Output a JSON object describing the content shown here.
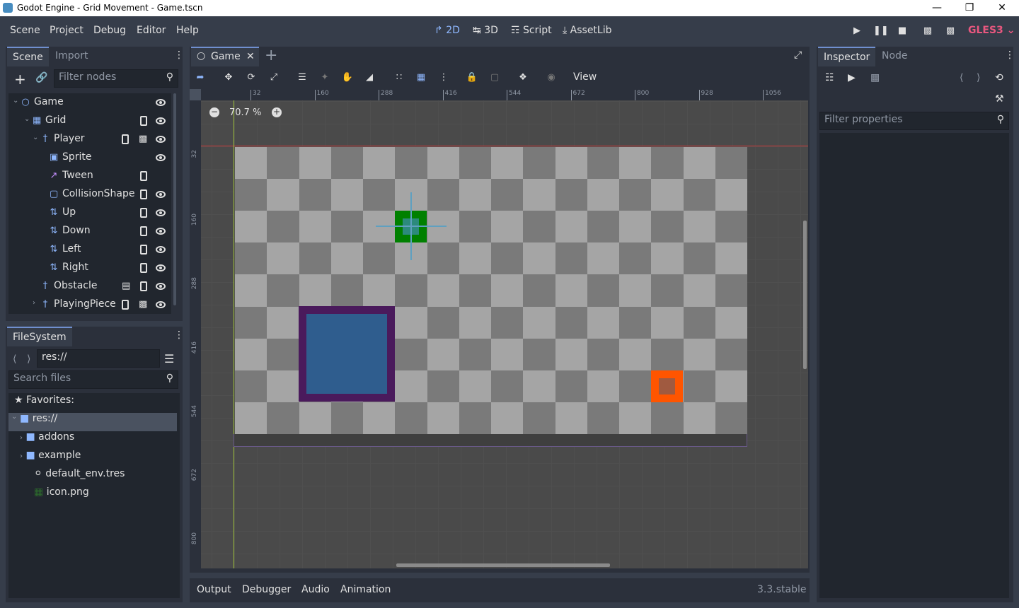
{
  "window": {
    "title": "Godot Engine - Grid Movement - Game.tscn"
  },
  "menu": {
    "scene": "Scene",
    "project": "Project",
    "debug": "Debug",
    "editor": "Editor",
    "help": "Help"
  },
  "workspaces": {
    "w2d": "2D",
    "w3d": "3D",
    "script": "Script",
    "assetlib": "AssetLib"
  },
  "renderer": "GLES3",
  "scene_dock": {
    "tab_scene": "Scene",
    "tab_import": "Import",
    "filter_placeholder": "Filter nodes",
    "nodes": [
      {
        "label": "Game",
        "icon": "node2d-icon"
      },
      {
        "label": "Grid",
        "icon": "tilemap-icon"
      },
      {
        "label": "Player",
        "icon": "pawn-icon"
      },
      {
        "label": "Sprite",
        "icon": "sprite-icon"
      },
      {
        "label": "Tween",
        "icon": "tween-icon"
      },
      {
        "label": "CollisionShape",
        "icon": "collision-icon"
      },
      {
        "label": "Up",
        "icon": "raycast-icon"
      },
      {
        "label": "Down",
        "icon": "raycast-icon"
      },
      {
        "label": "Left",
        "icon": "raycast-icon"
      },
      {
        "label": "Right",
        "icon": "raycast-icon"
      },
      {
        "label": "Obstacle",
        "icon": "pawn-icon"
      },
      {
        "label": "PlayingPiece",
        "icon": "pawn-icon"
      }
    ]
  },
  "filesystem": {
    "tab": "FileSystem",
    "path": "res://",
    "search_placeholder": "Search files",
    "favorites": "Favorites:",
    "items": [
      {
        "label": "res://"
      },
      {
        "label": "addons"
      },
      {
        "label": "example"
      },
      {
        "label": "default_env.tres"
      },
      {
        "label": "icon.png"
      }
    ]
  },
  "editor": {
    "tab": "Game",
    "view_menu": "View",
    "zoom": "70.7 %",
    "ruler_h": [
      "32",
      "160",
      "288",
      "416",
      "544",
      "672",
      "800",
      "928",
      "1056"
    ],
    "ruler_v": [
      "32",
      "160",
      "288",
      "416",
      "544",
      "672",
      "800"
    ]
  },
  "bottom_panel": {
    "output": "Output",
    "debugger": "Debugger",
    "audio": "Audio",
    "animation": "Animation",
    "version": "3.3.stable"
  },
  "inspector": {
    "tab_inspector": "Inspector",
    "tab_node": "Node",
    "filter_placeholder": "Filter properties"
  },
  "colors": {
    "accent": "#8fb8ff",
    "gles": "#e9577f",
    "player": "#008000",
    "obstacle": "#4a1a5c",
    "piece": "#ff5500"
  }
}
